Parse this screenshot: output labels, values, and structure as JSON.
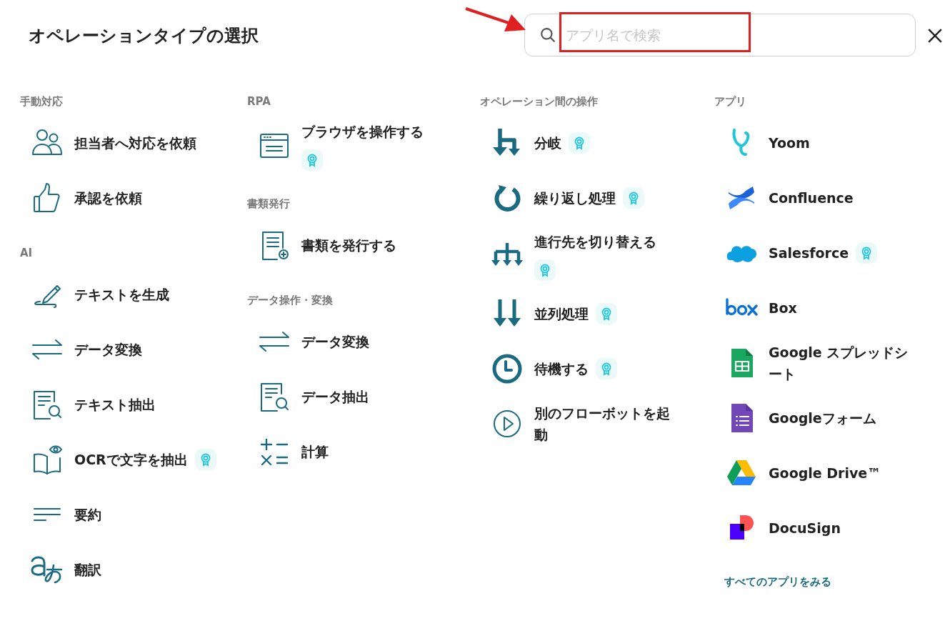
{
  "title": "オペレーションタイプの選択",
  "search": {
    "placeholder": "アプリ名で検索"
  },
  "columns": [
    {
      "sections": [
        {
          "heading": "手動対応",
          "items": [
            {
              "label": "担当者へ対応を依頼",
              "kind": "people",
              "premium": false
            },
            {
              "label": "承認を依頼",
              "kind": "thumb",
              "premium": false
            }
          ]
        },
        {
          "heading": "AI",
          "items": [
            {
              "label": "テキストを生成",
              "kind": "pen",
              "premium": false
            },
            {
              "label": "データ変換",
              "kind": "swap",
              "premium": false
            },
            {
              "label": "テキスト抽出",
              "kind": "docsearch",
              "premium": false
            },
            {
              "label": "OCRで文字を抽出",
              "kind": "bookeye",
              "premium": true
            },
            {
              "label": "要約",
              "kind": "lines",
              "premium": false
            },
            {
              "label": "翻訳",
              "kind": "translate",
              "premium": false
            }
          ]
        }
      ]
    },
    {
      "sections": [
        {
          "heading": "RPA",
          "items": [
            {
              "label": "ブラウザを操作する",
              "kind": "browser",
              "premium": true
            }
          ]
        },
        {
          "heading": "書類発行",
          "items": [
            {
              "label": "書類を発行する",
              "kind": "docplus",
              "premium": false
            }
          ]
        },
        {
          "heading": "データ操作・変換",
          "items": [
            {
              "label": "データ変換",
              "kind": "swap",
              "premium": false
            },
            {
              "label": "データ抽出",
              "kind": "docsearch",
              "premium": false
            },
            {
              "label": "計算",
              "kind": "calc",
              "premium": false
            }
          ]
        }
      ]
    },
    {
      "sections": [
        {
          "heading": "オペレーション間の操作",
          "items": [
            {
              "label": "分岐",
              "kind": "branch",
              "premium": true
            },
            {
              "label": "繰り返し処理",
              "kind": "loop",
              "premium": true
            },
            {
              "label": "進行先を切り替える",
              "kind": "switch",
              "premium": true
            },
            {
              "label": "並列処理",
              "kind": "parallel",
              "premium": true
            },
            {
              "label": "待機する",
              "kind": "clock",
              "premium": true
            },
            {
              "label": "別のフローボットを起動",
              "kind": "play",
              "premium": false
            }
          ]
        }
      ]
    },
    {
      "sections": [
        {
          "heading": "アプリ",
          "items": [
            {
              "label": "Yoom",
              "kind": "yoom",
              "premium": false
            },
            {
              "label": "Confluence",
              "kind": "confluence",
              "premium": false
            },
            {
              "label": "Salesforce",
              "kind": "cloud",
              "premium": true
            },
            {
              "label": "Box",
              "kind": "box",
              "premium": false
            },
            {
              "label": "Google スプレッドシート",
              "kind": "sheets",
              "premium": false
            },
            {
              "label": "Googleフォーム",
              "kind": "forms",
              "premium": false
            },
            {
              "label": "Google Drive™",
              "kind": "drive",
              "premium": false
            },
            {
              "label": "DocuSign",
              "kind": "docusign",
              "premium": false
            }
          ]
        }
      ],
      "link": "すべてのアプリをみる"
    }
  ]
}
